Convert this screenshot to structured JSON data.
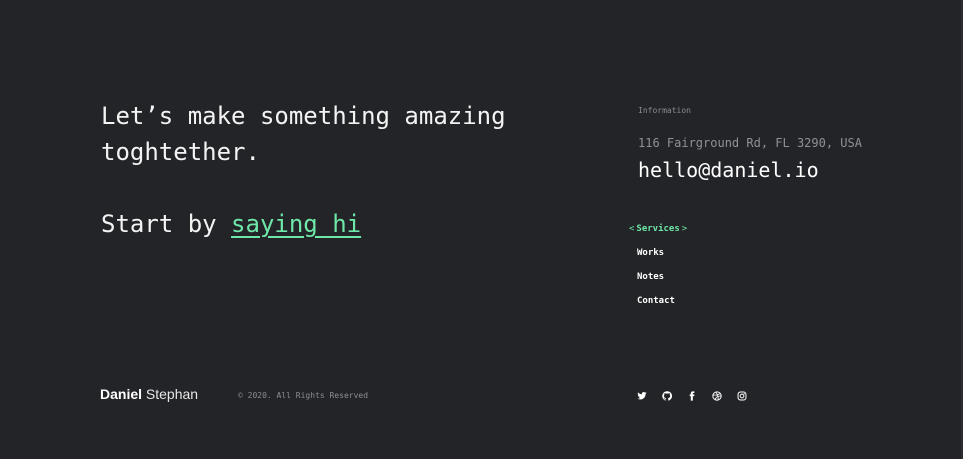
{
  "hero": {
    "headline": "Let’s make something amazing toghtether.",
    "cta_prefix": "Start by ",
    "cta_link": "saying hi"
  },
  "info": {
    "label": "Information",
    "address": "116 Fairground Rd, FL 3290, USA",
    "email": "hello@daniel.io"
  },
  "nav": {
    "items": [
      {
        "label": "Services",
        "active": true
      },
      {
        "label": "Works"
      },
      {
        "label": "Notes"
      },
      {
        "label": "Contact"
      }
    ],
    "active_open": "<",
    "active_close": ">"
  },
  "footer": {
    "brand_first": "Daniel",
    "brand_last": "Stephan",
    "copyright": "© 2020. All Rights Reserved",
    "social": [
      "twitter-icon",
      "github-icon",
      "facebook-icon",
      "dribbble-icon",
      "instagram-icon"
    ]
  },
  "colors": {
    "background": "#232427",
    "accent": "#6ee7a8",
    "muted": "#8b8d92"
  }
}
